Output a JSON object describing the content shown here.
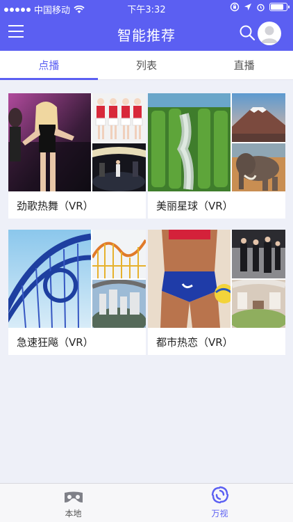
{
  "status_bar": {
    "carrier": "中国移动",
    "time": "下午3:32",
    "battery_level": 0.85
  },
  "header": {
    "title": "智能推荐",
    "menu_icon": "hamburger-menu-icon",
    "search_icon": "search-icon",
    "avatar_icon": "avatar-icon"
  },
  "tabs": [
    {
      "label": "点播",
      "active": true
    },
    {
      "label": "列表",
      "active": false
    },
    {
      "label": "直播",
      "active": false
    }
  ],
  "cards": [
    {
      "title": "劲歌热舞（VR）"
    },
    {
      "title": "美丽星球（VR）"
    },
    {
      "title": "急速狂飚（VR）"
    },
    {
      "title": "都市热恋（VR）"
    }
  ],
  "bottom_nav": [
    {
      "label": "本地",
      "icon": "vr-glasses-icon",
      "active": false
    },
    {
      "label": "万视",
      "icon": "swirl-logo-icon",
      "active": true
    }
  ],
  "colors": {
    "accent": "#5b5ff2",
    "background": "#eef0f8"
  }
}
